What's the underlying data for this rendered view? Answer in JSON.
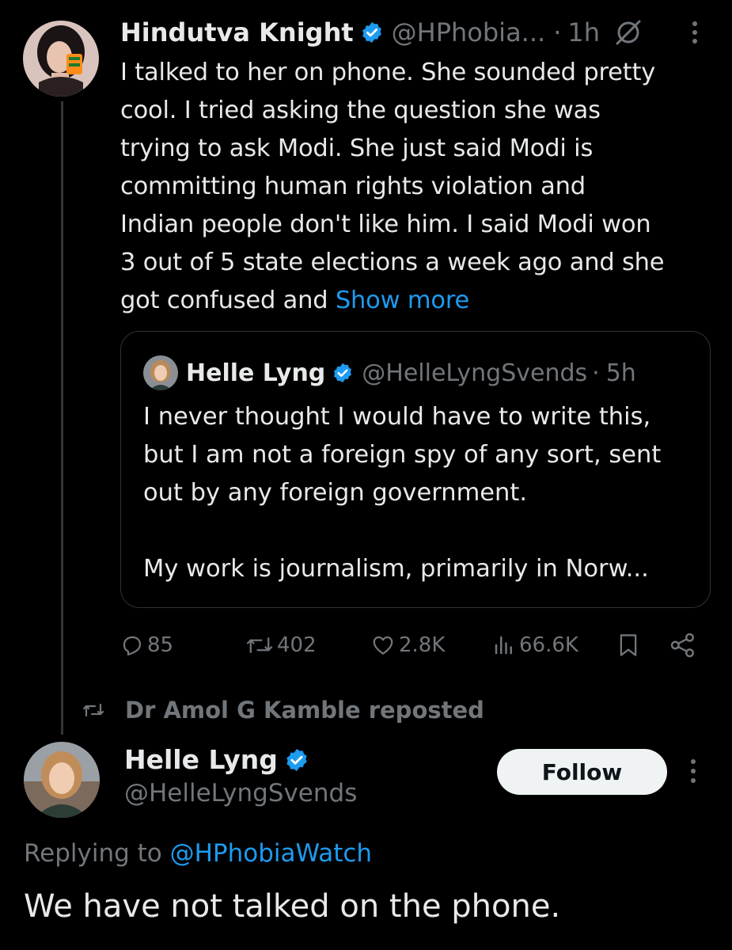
{
  "tweet1": {
    "author_name": "Hindutva Knight",
    "handle": "@HPhobia...",
    "separator": "·",
    "time": "1h",
    "body_lines": [
      "I talked to her on phone. She sounded pretty",
      "cool. I tried asking the question she was",
      "trying to ask Modi. She just said Modi is",
      "committing human rights violation and",
      "Indian people don't like him. I said Modi won",
      "3 out of 5 state elections a week ago and she",
      "got confused and "
    ],
    "show_more": "Show more",
    "quote": {
      "author_name": "Helle Lyng",
      "handle": "@HelleLyngSvends",
      "separator": "·",
      "time": "5h",
      "body_lines": [
        "I never thought I would have to write this,",
        "but I am not a foreign spy of any sort, sent",
        "out by any foreign government."
      ],
      "body_lines_2": [
        "My work is journalism, primarily in Norw..."
      ]
    },
    "actions": {
      "replies": "85",
      "reposts": "402",
      "likes": "2.8K",
      "views": "66.6K"
    }
  },
  "repost_notice": "Dr Amol G Kamble reposted",
  "tweet2": {
    "author_name": "Helle Lyng",
    "handle": "@HelleLyngSvends",
    "follow_label": "Follow",
    "replying_prefix": "Replying to ",
    "replying_handle": "@HPhobiaWatch",
    "body": "We have not talked on the phone."
  },
  "colors": {
    "background": "#000000",
    "text": "#e7e9ea",
    "muted": "#71767b",
    "link": "#1d9bf0",
    "verified": "#1d9bf0",
    "border": "#2f3336"
  }
}
